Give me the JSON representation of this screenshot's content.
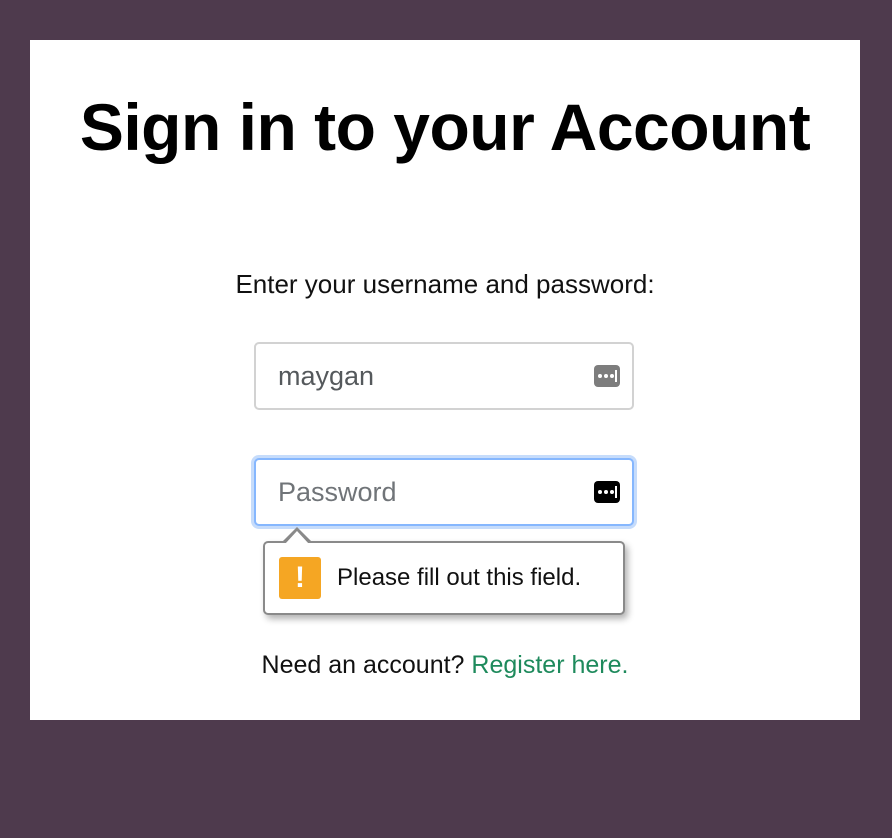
{
  "page": {
    "title": "Sign in to your Account",
    "subtitle": "Enter your username and password:"
  },
  "form": {
    "username_value": "maygan",
    "password_value": "",
    "password_placeholder": "Password",
    "username_icon": "password-manager-key-icon",
    "password_icon": "password-manager-key-icon"
  },
  "validation": {
    "message": "Please fill out this field.",
    "icon": "warning-exclamation-icon",
    "icon_glyph": "!",
    "icon_color": "#f5a623"
  },
  "footer": {
    "prompt": "Need an account?",
    "link_text": "Register here.",
    "link_color": "#1e8a5c"
  },
  "colors": {
    "background": "#4e3a4d",
    "card": "#ffffff",
    "focus_ring": "#86b7fe"
  }
}
